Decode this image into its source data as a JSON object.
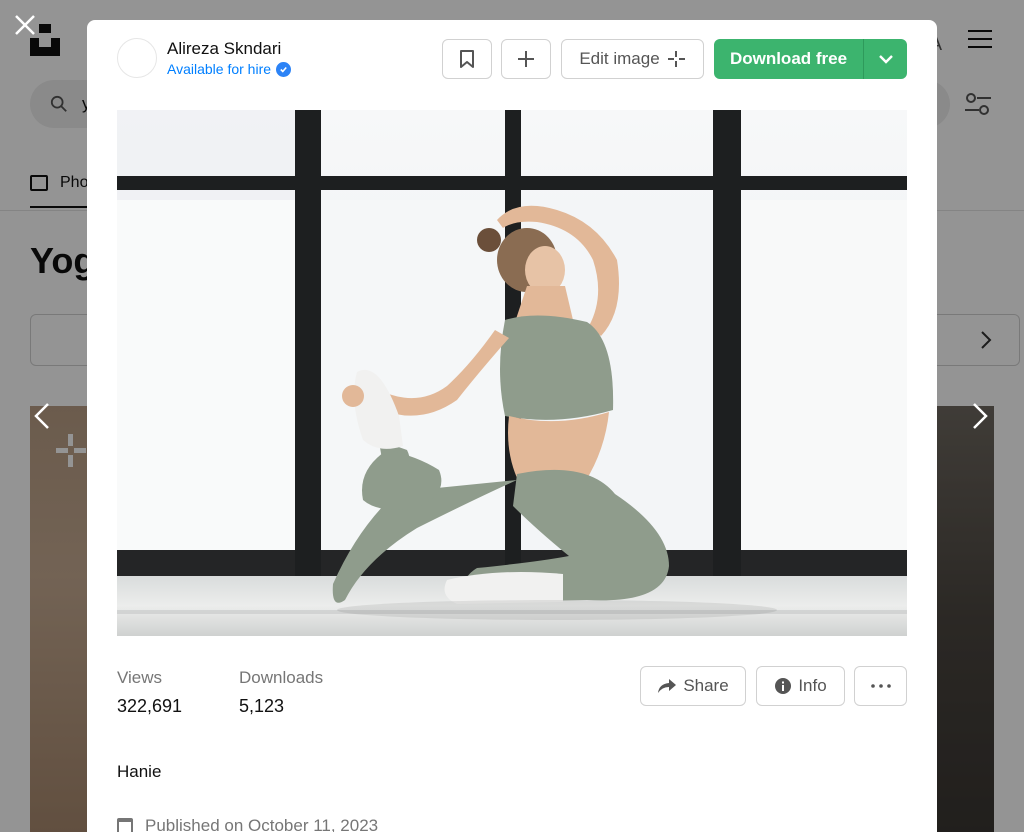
{
  "background": {
    "search_value": "y",
    "tab_label": "Pho",
    "page_title": "Yog",
    "header_letter": "A"
  },
  "modal": {
    "author": {
      "name": "Alireza Skndari",
      "hire_label": "Available for hire"
    },
    "toolbar": {
      "edit_label": "Edit image",
      "download_label": "Download free"
    },
    "stats": {
      "views_label": "Views",
      "views_value": "322,691",
      "downloads_label": "Downloads",
      "downloads_value": "5,123"
    },
    "actions": {
      "share_label": "Share",
      "info_label": "Info"
    },
    "description": "Hanie",
    "published": "Published on October 11, 2023"
  },
  "icons": [
    "close-icon",
    "bookmark-icon",
    "plus-icon",
    "sparkle-icon",
    "chevron-down-icon",
    "share-arrow-icon",
    "info-icon",
    "more-icon",
    "calendar-icon",
    "chevron-left-icon",
    "chevron-right-icon",
    "verified-icon"
  ],
  "colors": {
    "download_green": "#3cb46e",
    "hire_blue": "#007fff",
    "overlay": "rgba(0,0,0,0.42)"
  }
}
